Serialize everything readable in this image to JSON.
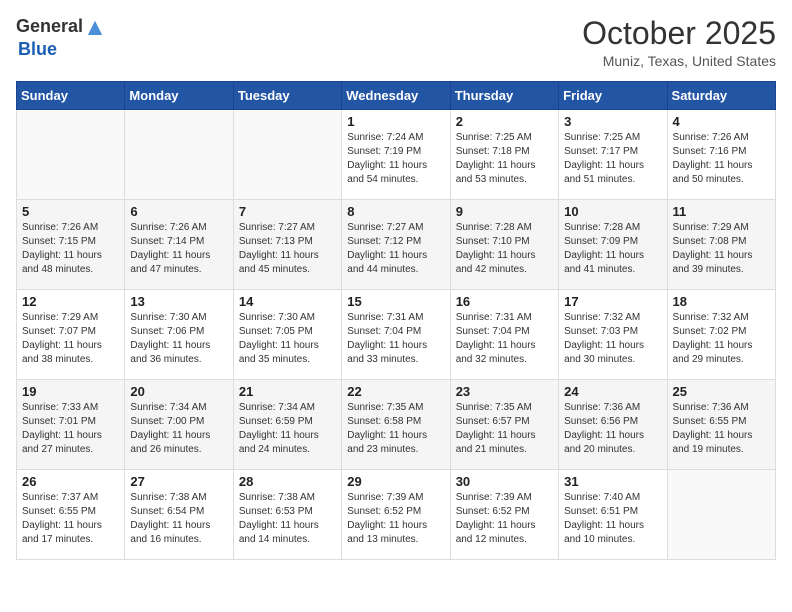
{
  "logo": {
    "text_general": "General",
    "text_blue": "Blue"
  },
  "title": {
    "month_year": "October 2025",
    "location": "Muniz, Texas, United States"
  },
  "weekdays": [
    "Sunday",
    "Monday",
    "Tuesday",
    "Wednesday",
    "Thursday",
    "Friday",
    "Saturday"
  ],
  "weeks": [
    [
      {
        "day": "",
        "info": ""
      },
      {
        "day": "",
        "info": ""
      },
      {
        "day": "",
        "info": ""
      },
      {
        "day": "1",
        "info": "Sunrise: 7:24 AM\nSunset: 7:19 PM\nDaylight: 11 hours and 54 minutes."
      },
      {
        "day": "2",
        "info": "Sunrise: 7:25 AM\nSunset: 7:18 PM\nDaylight: 11 hours and 53 minutes."
      },
      {
        "day": "3",
        "info": "Sunrise: 7:25 AM\nSunset: 7:17 PM\nDaylight: 11 hours and 51 minutes."
      },
      {
        "day": "4",
        "info": "Sunrise: 7:26 AM\nSunset: 7:16 PM\nDaylight: 11 hours and 50 minutes."
      }
    ],
    [
      {
        "day": "5",
        "info": "Sunrise: 7:26 AM\nSunset: 7:15 PM\nDaylight: 11 hours and 48 minutes."
      },
      {
        "day": "6",
        "info": "Sunrise: 7:26 AM\nSunset: 7:14 PM\nDaylight: 11 hours and 47 minutes."
      },
      {
        "day": "7",
        "info": "Sunrise: 7:27 AM\nSunset: 7:13 PM\nDaylight: 11 hours and 45 minutes."
      },
      {
        "day": "8",
        "info": "Sunrise: 7:27 AM\nSunset: 7:12 PM\nDaylight: 11 hours and 44 minutes."
      },
      {
        "day": "9",
        "info": "Sunrise: 7:28 AM\nSunset: 7:10 PM\nDaylight: 11 hours and 42 minutes."
      },
      {
        "day": "10",
        "info": "Sunrise: 7:28 AM\nSunset: 7:09 PM\nDaylight: 11 hours and 41 minutes."
      },
      {
        "day": "11",
        "info": "Sunrise: 7:29 AM\nSunset: 7:08 PM\nDaylight: 11 hours and 39 minutes."
      }
    ],
    [
      {
        "day": "12",
        "info": "Sunrise: 7:29 AM\nSunset: 7:07 PM\nDaylight: 11 hours and 38 minutes."
      },
      {
        "day": "13",
        "info": "Sunrise: 7:30 AM\nSunset: 7:06 PM\nDaylight: 11 hours and 36 minutes."
      },
      {
        "day": "14",
        "info": "Sunrise: 7:30 AM\nSunset: 7:05 PM\nDaylight: 11 hours and 35 minutes."
      },
      {
        "day": "15",
        "info": "Sunrise: 7:31 AM\nSunset: 7:04 PM\nDaylight: 11 hours and 33 minutes."
      },
      {
        "day": "16",
        "info": "Sunrise: 7:31 AM\nSunset: 7:04 PM\nDaylight: 11 hours and 32 minutes."
      },
      {
        "day": "17",
        "info": "Sunrise: 7:32 AM\nSunset: 7:03 PM\nDaylight: 11 hours and 30 minutes."
      },
      {
        "day": "18",
        "info": "Sunrise: 7:32 AM\nSunset: 7:02 PM\nDaylight: 11 hours and 29 minutes."
      }
    ],
    [
      {
        "day": "19",
        "info": "Sunrise: 7:33 AM\nSunset: 7:01 PM\nDaylight: 11 hours and 27 minutes."
      },
      {
        "day": "20",
        "info": "Sunrise: 7:34 AM\nSunset: 7:00 PM\nDaylight: 11 hours and 26 minutes."
      },
      {
        "day": "21",
        "info": "Sunrise: 7:34 AM\nSunset: 6:59 PM\nDaylight: 11 hours and 24 minutes."
      },
      {
        "day": "22",
        "info": "Sunrise: 7:35 AM\nSunset: 6:58 PM\nDaylight: 11 hours and 23 minutes."
      },
      {
        "day": "23",
        "info": "Sunrise: 7:35 AM\nSunset: 6:57 PM\nDaylight: 11 hours and 21 minutes."
      },
      {
        "day": "24",
        "info": "Sunrise: 7:36 AM\nSunset: 6:56 PM\nDaylight: 11 hours and 20 minutes."
      },
      {
        "day": "25",
        "info": "Sunrise: 7:36 AM\nSunset: 6:55 PM\nDaylight: 11 hours and 19 minutes."
      }
    ],
    [
      {
        "day": "26",
        "info": "Sunrise: 7:37 AM\nSunset: 6:55 PM\nDaylight: 11 hours and 17 minutes."
      },
      {
        "day": "27",
        "info": "Sunrise: 7:38 AM\nSunset: 6:54 PM\nDaylight: 11 hours and 16 minutes."
      },
      {
        "day": "28",
        "info": "Sunrise: 7:38 AM\nSunset: 6:53 PM\nDaylight: 11 hours and 14 minutes."
      },
      {
        "day": "29",
        "info": "Sunrise: 7:39 AM\nSunset: 6:52 PM\nDaylight: 11 hours and 13 minutes."
      },
      {
        "day": "30",
        "info": "Sunrise: 7:39 AM\nSunset: 6:52 PM\nDaylight: 11 hours and 12 minutes."
      },
      {
        "day": "31",
        "info": "Sunrise: 7:40 AM\nSunset: 6:51 PM\nDaylight: 11 hours and 10 minutes."
      },
      {
        "day": "",
        "info": ""
      }
    ]
  ]
}
